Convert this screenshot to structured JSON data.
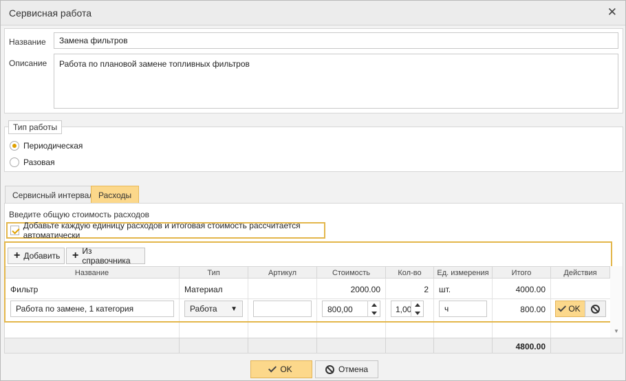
{
  "dialog": {
    "title": "Сервисная работа",
    "close_icon": "close-icon"
  },
  "form": {
    "name_label": "Название",
    "name_value": "Замена фильтров",
    "description_label": "Описание",
    "description_value": "Работа по плановой замене топливных фильтров"
  },
  "work_type": {
    "legend": "Тип работы",
    "options": [
      {
        "label": "Периодическая",
        "selected": true
      },
      {
        "label": "Разовая",
        "selected": false
      }
    ]
  },
  "tabs": [
    {
      "label": "Сервисный интервал",
      "active": false
    },
    {
      "label": "Расходы",
      "active": true
    }
  ],
  "expenses": {
    "total_cost_label": "Введите общую стоимость расходов",
    "auto_calc_label": "Добавьте каждую единицу расходов и итоговая стоимость рассчитается автоматически",
    "auto_calc_checked": true,
    "add_label": "Добавить",
    "catalog_label": "Из справочника",
    "columns": [
      "Название",
      "Тип",
      "Артикул",
      "Стоимость",
      "Кол-во",
      "Ед. измерения",
      "Итого",
      "Действия"
    ],
    "row1": {
      "name": "Фильтр",
      "type": "Материал",
      "sku": "",
      "cost": "2000.00",
      "qty": "2",
      "unit": "шт.",
      "total": "4000.00"
    },
    "edit_row": {
      "name": "Работа по замене, 1 категория",
      "type": "Работа",
      "sku": "",
      "cost": "800,00",
      "qty": "1,00",
      "unit": "ч",
      "total": "800.00",
      "ok_label": "OK"
    },
    "grand_total": "4800.00"
  },
  "footer": {
    "ok_label": "OK",
    "cancel_label": "Отмена"
  },
  "colors": {
    "accent": "#fcd88b",
    "highlight_border": "#e3b64a",
    "radio_dot": "#e0a100"
  }
}
